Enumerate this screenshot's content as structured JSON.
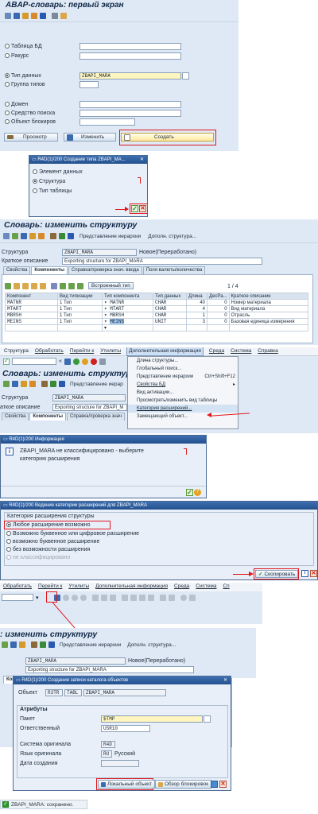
{
  "p1": {
    "title": "ABAP-словарь: первый экран",
    "radios": [
      "Таблица БД",
      "Ракурс",
      "Тип данных",
      "Группа типов",
      "Домен",
      "Средство поиска",
      "Объект блокиров"
    ],
    "selected": "Тип данных",
    "type_value": "ZBAPI_MARA",
    "btn_view": "Просмотр",
    "btn_change": "Изменить",
    "btn_create": "Создать"
  },
  "d1": {
    "title": "R4D(1)/200 Создание типа ZBAPI_MA...",
    "options": [
      "Элемент данных",
      "Структура",
      "Тип таблицы"
    ],
    "selected": "Структура"
  },
  "p2": {
    "title": "Словарь: изменить структуру",
    "toolbar": [
      "Представление иерархии",
      "Дополн. структура..."
    ],
    "struct_label": "Структура",
    "struct_value": "ZBAPI_MARA",
    "status": "Новое(Переработано)",
    "desc_label": "Краткое описание",
    "desc_value": "Exporting structure for ZBAPI_MARA",
    "tabs": [
      "Свойства",
      "Компоненты",
      "Справка/проверка знач. ввода",
      "Поля валюты/количества"
    ],
    "builtin_btn": "Встроенный тип",
    "pager": "1 / 4",
    "cols": [
      "Компонент",
      "Вид типизации",
      "Тип компонента",
      "Тип данных",
      "Длина",
      "ДесРа...",
      "Краткое описание"
    ],
    "rows": [
      [
        "MATNR",
        "1 Тип",
        "MATNR",
        "CHAR",
        "40",
        "0",
        "Номер материала"
      ],
      [
        "MTART",
        "1 Тип",
        "MTART",
        "CHAR",
        "4",
        "0",
        "Вид материала"
      ],
      [
        "MBRSH",
        "1 Тип",
        "MBRSH",
        "CHAR",
        "1",
        "0",
        "Отрасль"
      ],
      [
        "MEINS",
        "1 Тип",
        "MEINS",
        "UNIT",
        "3",
        "0",
        "Базовая единица измерения"
      ]
    ]
  },
  "p3": {
    "menubar": [
      "Структура",
      "Обработать",
      "Перейти к",
      "Утилиты",
      "Дополнительная информация",
      "Среда",
      "Система",
      "Справка"
    ],
    "title": "Словарь: изменить структуру",
    "hier": "Представление иерар",
    "struct_label": "Структура",
    "struct_value": "ZBAPI_MARA",
    "desc_label": "аткое описание",
    "desc_value": "Exporting structure for ZBAPI_M",
    "tabs": [
      "Свойства",
      "Компоненты",
      "Справка/проверка знач"
    ],
    "menu": [
      "Длина структуры...",
      "Глобальный поиск...",
      "Представление иерархии",
      "Свойства БД",
      "Вид активации...",
      "Просмотреть/изменить вид таблицы",
      "Категория расширений...",
      "Замещающий объект..."
    ],
    "shortcut": "Ctrl+Shift+F12"
  },
  "d2": {
    "title": "R4D(1)/200 Информация",
    "msg1": "ZBAPI_MARA не классифицировано - выберите",
    "msg2": "категорию расширения"
  },
  "d3": {
    "title": "R4D(1)/200 Ведение категории расширений для ZBAPI_MARA",
    "group": "Категория расширения структуры",
    "options": [
      "Любое расширение возможно",
      "Возможно буквенное или цифровое расширение",
      "возможно буквенное расширение",
      "без возможности расширения",
      "не классифицировано"
    ],
    "selected": "Любое расширение возможно",
    "copy_btn": "Скопировать"
  },
  "p4": {
    "menubar": [
      "Обработать",
      "Перейти к",
      "Утилиты",
      "Дополнительная информация",
      "Среда",
      "Система",
      "Сп"
    ],
    "title": ": изменить структуру",
    "toolbar": [
      "Представление иерархии",
      "Дополн. структура..."
    ],
    "struct_value": "ZBAPI_MARA",
    "status": "Новое(Переработано)",
    "desc_value": "Exporting structure for ZBAPI_MARA",
    "tab": "Ком"
  },
  "d4": {
    "title": "R4D(1)/200 Создание записи каталога объектов",
    "obj_label": "Объект",
    "obj_r3tr": "R3TR",
    "obj_tabl": "TABL",
    "obj_name": "ZBAPI_MARA",
    "attrs": "Атрибуты",
    "pkg_label": "Пакет",
    "pkg_value": "$TMP",
    "resp_label": "Ответственный",
    "resp_value": "USR10",
    "sys_label": "Система оригинала",
    "sys_value": "R4D",
    "lang_label": "Язык оригинала",
    "lang_code": "RU",
    "lang_name": "Русский",
    "date_label": "Дата создания",
    "local_btn": "Локальный объект",
    "lock_btn": "Обзор блокировок"
  },
  "status_msg": "ZBAPI_MARA: сохранено.",
  "colors": {
    "highlight": "#e0161e",
    "title_bar": "#23508e",
    "background": "#dfe9f5"
  }
}
